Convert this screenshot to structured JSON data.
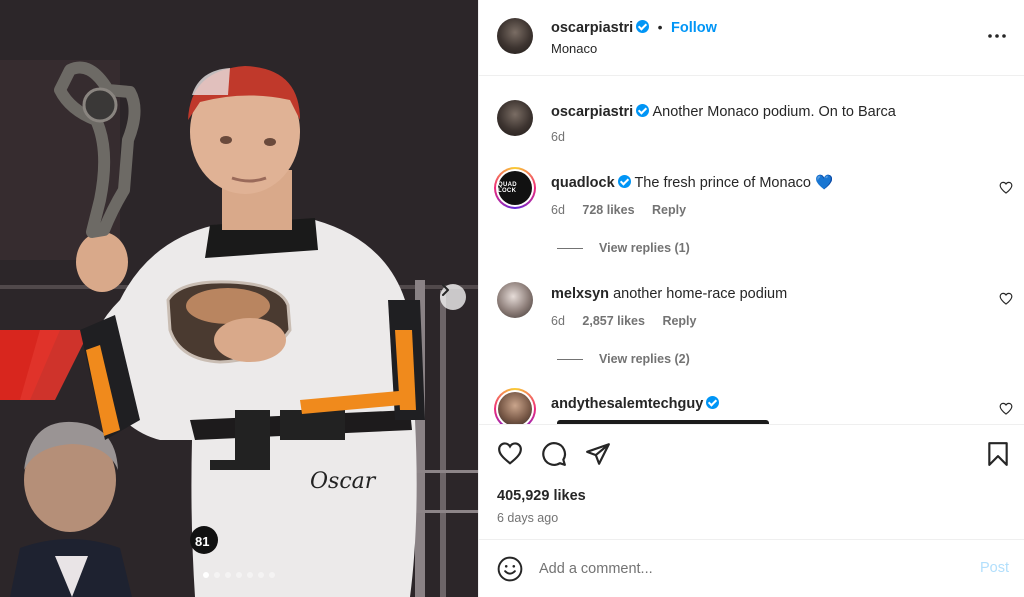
{
  "post": {
    "username": "oscarpiastri",
    "verified": true,
    "follow_label": "Follow",
    "separator": "•",
    "location": "Monaco"
  },
  "caption": {
    "username": "oscarpiastri",
    "text": "Another Monaco podium. On to Barca",
    "time": "6d"
  },
  "comments": [
    {
      "username": "quadlock",
      "verified": true,
      "text": "The fresh prince of Monaco",
      "emoji": "💙",
      "time": "6d",
      "likes": "728 likes",
      "reply_label": "Reply",
      "view_replies": "View replies (1)"
    },
    {
      "username": "melxsyn",
      "verified": false,
      "text": "another home-race podium",
      "time": "6d",
      "likes": "2,857 likes",
      "reply_label": "Reply",
      "view_replies": "View replies (2)"
    },
    {
      "username": "andythesalemtechguy",
      "verified": true,
      "text": ""
    }
  ],
  "quadlock_logo_text": "QUAD LOCK",
  "stats": {
    "likes": "405,929 likes",
    "posted": "6 days ago"
  },
  "add_comment": {
    "placeholder": "Add a comment...",
    "post_label": "Post"
  },
  "carousel": {
    "total": 7,
    "active": 0
  },
  "colors": {
    "accent": "#0095f6",
    "text": "#262626",
    "muted": "#737373",
    "border": "#efefef"
  },
  "icons": [
    "more-icon",
    "heart-icon",
    "comment-icon",
    "share-icon",
    "bookmark-icon",
    "emoji-icon",
    "chevron-right-icon",
    "verified-icon"
  ]
}
